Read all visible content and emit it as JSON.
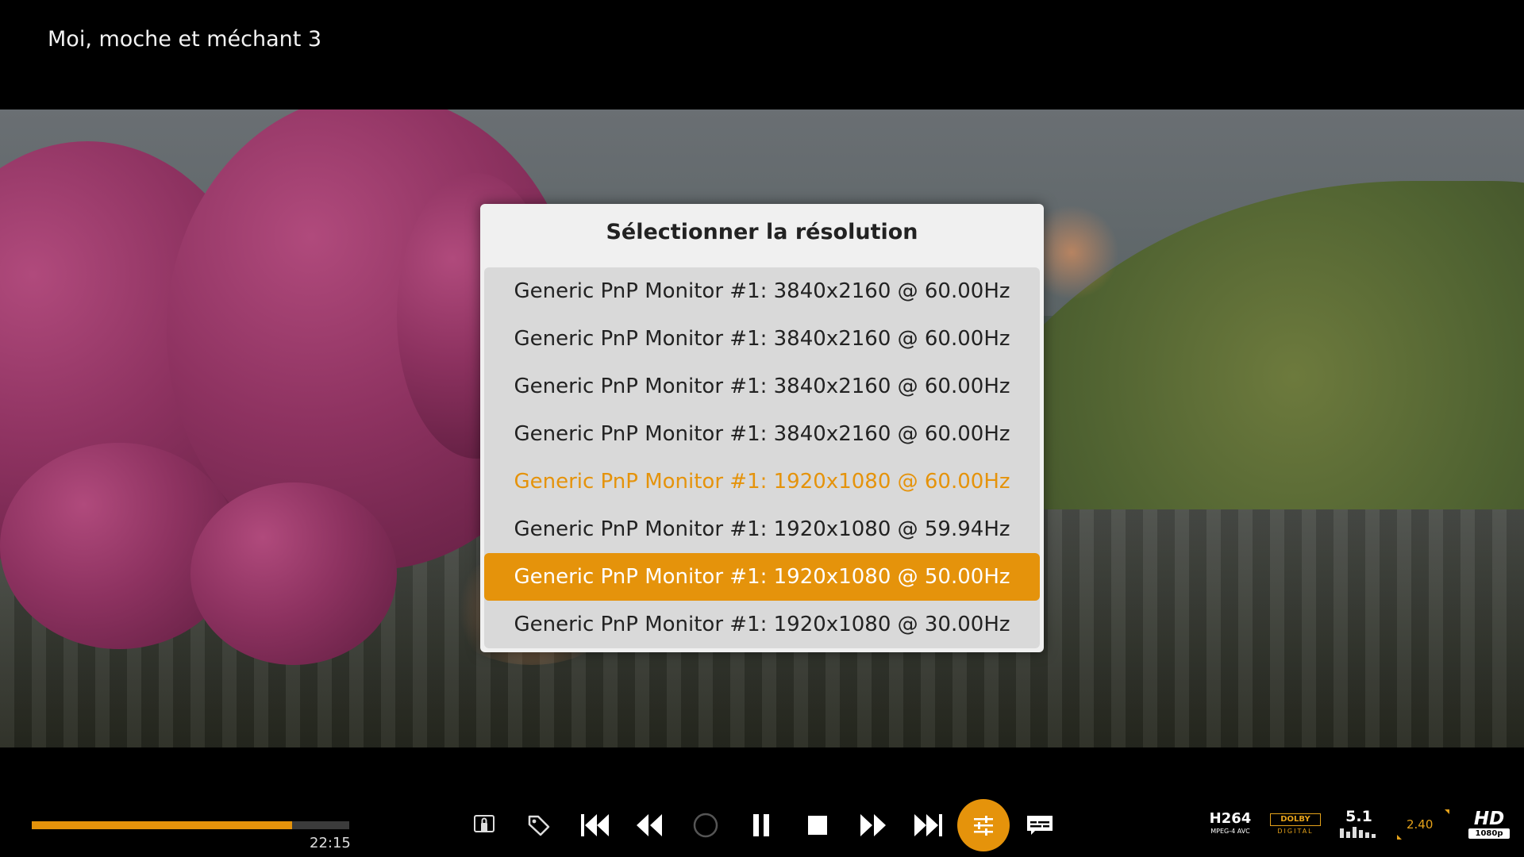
{
  "header": {
    "title": "Moi, moche et méchant 3"
  },
  "dialog": {
    "title": "Sélectionner la résolution",
    "items": [
      {
        "label": "Generic PnP Monitor #1: 3840x2160 @ 60.00Hz"
      },
      {
        "label": "Generic PnP Monitor #1: 3840x2160 @ 60.00Hz"
      },
      {
        "label": "Generic PnP Monitor #1: 3840x2160 @ 60.00Hz"
      },
      {
        "label": "Generic PnP Monitor #1: 3840x2160 @ 60.00Hz"
      },
      {
        "label": "Generic PnP Monitor #1: 1920x1080 @ 60.00Hz",
        "state": "current"
      },
      {
        "label": "Generic PnP Monitor #1: 1920x1080 @ 59.94Hz"
      },
      {
        "label": "Generic PnP Monitor #1: 1920x1080 @ 50.00Hz",
        "state": "focused"
      },
      {
        "label": "Generic PnP Monitor #1: 1920x1080 @ 30.00Hz"
      }
    ]
  },
  "player": {
    "progress_fraction": 0.82,
    "time": "22:15",
    "controls": [
      "remote-lock-icon",
      "tag-icon",
      "skip-previous-icon",
      "rewind-icon",
      "record-icon",
      "pause-icon",
      "stop-icon",
      "fast-forward-icon",
      "skip-next-icon",
      "settings-sliders-icon",
      "subtitles-icon"
    ],
    "badges": {
      "codec": "H264",
      "codec_sub": "MPEG-4 AVC",
      "audio_brand": "DOLBY",
      "audio_sub": "DIGITAL",
      "channels": "5.1",
      "aspect": "2.40",
      "hd": "HD",
      "resolution": "1080p"
    }
  },
  "colors": {
    "accent": "#e5930b",
    "dialog_bg": "#f0f0f0",
    "list_bg": "#d9d9d9"
  }
}
